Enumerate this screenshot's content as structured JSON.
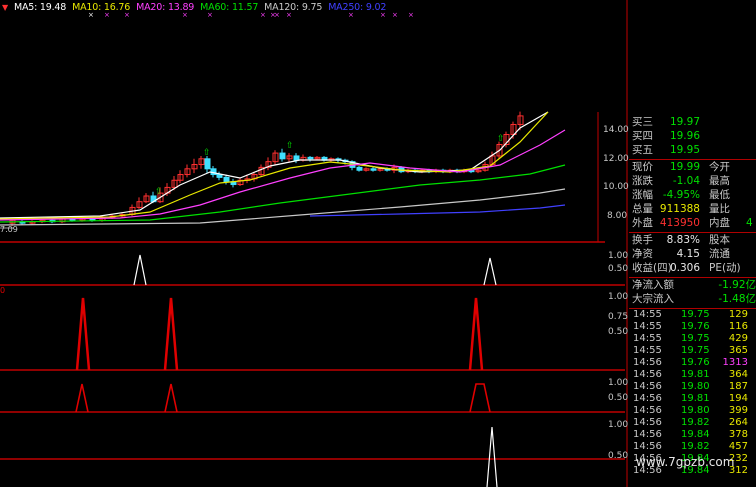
{
  "ma_bar": {
    "indicator_icon": "red-down-triangle",
    "ma5": "MA5: 19.48",
    "ma10": "MA10: 16.76",
    "ma20": "MA20: 13.89",
    "ma60": "MA60: 11.57",
    "ma120": "MA120: 9.75",
    "ma250": "MA250: 9.02"
  },
  "colors": {
    "ma5": "#ffffff",
    "ma10": "#e8e800",
    "ma20": "#ff40ff",
    "ma60": "#00e000",
    "ma120": "#c8c8c8",
    "ma250": "#4040ff",
    "grid": "#b00000",
    "up": "#ff3030",
    "down": "#40e0ff"
  },
  "price_axis": [
    "14.00",
    "12.00",
    "10.00",
    "8.00"
  ],
  "price_low_label": "7.09",
  "signal_axis": {
    "p1": [
      "1.00",
      "0.50"
    ],
    "p2": [
      "1.00",
      "0.75",
      "0.50"
    ],
    "p3": [
      "1.00",
      "0.50"
    ],
    "p4": [
      "1.00",
      "0.50"
    ]
  },
  "quote": {
    "buy3": {
      "label": "买三",
      "value": "19.97"
    },
    "buy4": {
      "label": "买四",
      "value": "19.96"
    },
    "buy5": {
      "label": "买五",
      "value": "19.95"
    },
    "price": {
      "label": "现价",
      "value": "19.99",
      "label2": "今开"
    },
    "change": {
      "label": "涨跌",
      "value": "-1.04",
      "label2": "最高"
    },
    "change_pct": {
      "label": "涨幅",
      "value": "-4.95%",
      "label2": "最低"
    },
    "volume": {
      "label": "总量",
      "value": "911388",
      "label2": "量比"
    },
    "outer": {
      "label": "外盘",
      "value": "413950",
      "label2": "内盘",
      "value2": "4"
    },
    "turnover": {
      "label": "换手",
      "value": "8.83%",
      "label2": "股本"
    },
    "net_assets": {
      "label": "净资",
      "value": "4.15",
      "label2": "流通"
    },
    "earnings": {
      "label": "收益(四)",
      "value": "0.306",
      "label2": "PE(动)"
    },
    "net_inflow": {
      "label": "净流入额",
      "value": "-1.92亿"
    },
    "block_inflow": {
      "label": "大宗流入",
      "value": "-1.48亿"
    }
  },
  "ticks": [
    {
      "time": "14:55",
      "price": "19.75",
      "vol": "129",
      "vol_color": "#e8e800"
    },
    {
      "time": "14:55",
      "price": "19.76",
      "vol": "116",
      "vol_color": "#e8e800"
    },
    {
      "time": "14:55",
      "price": "19.75",
      "vol": "429",
      "vol_color": "#e8e800"
    },
    {
      "time": "14:55",
      "price": "19.75",
      "vol": "365",
      "vol_color": "#e8e800"
    },
    {
      "time": "14:56",
      "price": "19.76",
      "vol": "1313",
      "vol_color": "#ff40ff"
    },
    {
      "time": "14:56",
      "price": "19.81",
      "vol": "364",
      "vol_color": "#e8e800"
    },
    {
      "time": "14:56",
      "price": "19.80",
      "vol": "187",
      "vol_color": "#e8e800"
    },
    {
      "time": "14:56",
      "price": "19.81",
      "vol": "194",
      "vol_color": "#e8e800"
    },
    {
      "time": "14:56",
      "price": "19.80",
      "vol": "399",
      "vol_color": "#e8e800"
    },
    {
      "time": "14:56",
      "price": "19.82",
      "vol": "264",
      "vol_color": "#e8e800"
    },
    {
      "time": "14:56",
      "price": "19.84",
      "vol": "378",
      "vol_color": "#e8e800"
    },
    {
      "time": "14:56",
      "price": "19.82",
      "vol": "457",
      "vol_color": "#e8e800"
    },
    {
      "time": "14:56",
      "price": "19.84",
      "vol": "232",
      "vol_color": "#e8e800"
    },
    {
      "time": "14:56",
      "price": "19.84",
      "vol": "312",
      "vol_color": "#e8e800"
    }
  ],
  "watermark": "www.7gpzb.com"
}
